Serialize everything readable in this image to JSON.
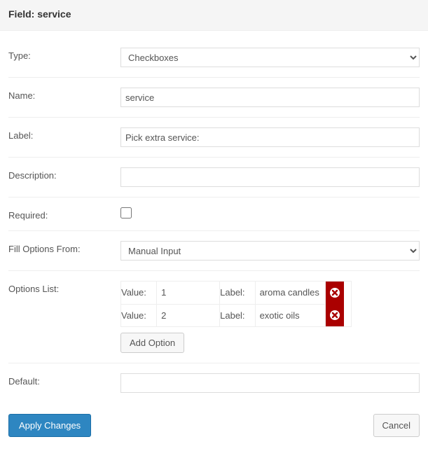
{
  "header": {
    "title": "Field: service"
  },
  "labels": {
    "type": "Type:",
    "name": "Name:",
    "label": "Label:",
    "description": "Description:",
    "required": "Required:",
    "fill": "Fill Options From:",
    "options": "Options List:",
    "default": "Default:",
    "value": "Value:",
    "labelcol": "Label:"
  },
  "values": {
    "type": "Checkboxes",
    "name": "service",
    "label": "Pick extra service:",
    "description": "",
    "required": false,
    "fill": "Manual Input",
    "default": ""
  },
  "options": [
    {
      "value": "1",
      "label": "aroma candles"
    },
    {
      "value": "2",
      "label": "exotic oils"
    }
  ],
  "buttons": {
    "add": "Add Option",
    "apply": "Apply Changes",
    "cancel": "Cancel"
  }
}
